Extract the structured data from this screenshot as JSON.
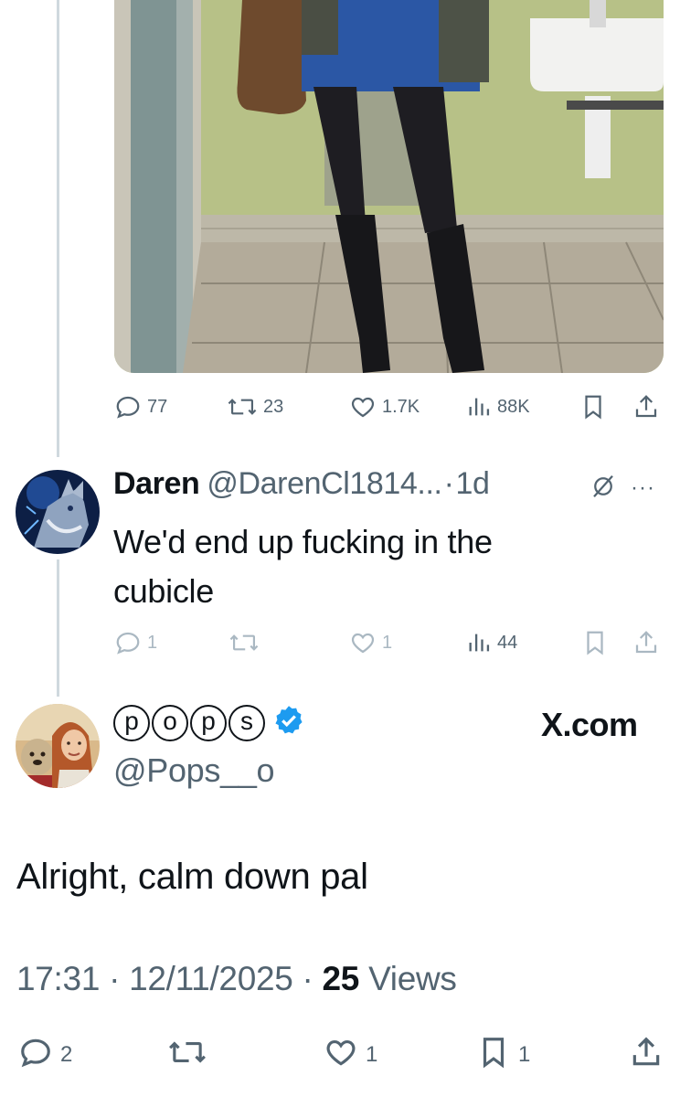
{
  "first_tweet": {
    "photo_alt": "",
    "actions": {
      "replies": "77",
      "reposts": "23",
      "likes": "1.7K",
      "views": "88K"
    }
  },
  "reply": {
    "name": "Daren",
    "handle": "@DarenCl1814...",
    "separator": "·",
    "time": "1d",
    "text": "We'd end up fucking in the cubicle",
    "more": "···",
    "actions": {
      "replies": "1",
      "reposts": "",
      "likes": "1",
      "views": "44"
    }
  },
  "main_tweet": {
    "display_name_letters": [
      "p",
      "o",
      "p",
      "s"
    ],
    "handle": "@Pops__o",
    "watermark": "X.com",
    "text": "Alright, calm down pal",
    "time": "17:31",
    "date": "12/11/2025",
    "separator": "·",
    "views_count": "25",
    "views_label": "Views",
    "actions": {
      "replies": "2",
      "reposts": "",
      "likes": "1",
      "bookmarks": "1"
    }
  },
  "colors": {
    "verified": "#1d9bf0",
    "secondary_text": "#536471",
    "muted_icon": "#aab8c2",
    "thread_line": "#cfd9de"
  }
}
